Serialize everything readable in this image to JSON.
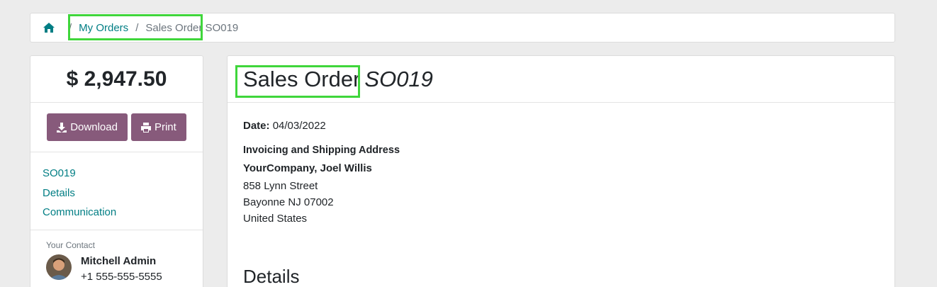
{
  "breadcrumb": {
    "home_icon": "home-icon",
    "separator": "/",
    "my_orders": "My Orders",
    "current": "Sales Order SO019"
  },
  "sidebar": {
    "amount": "$ 2,947.50",
    "download_label": "Download",
    "print_label": "Print",
    "links": [
      "SO019",
      "Details",
      "Communication"
    ],
    "contact_label": "Your Contact",
    "contact_name": "Mitchell Admin",
    "contact_phone": "+1 555-555-5555"
  },
  "main": {
    "title": "Sales Order",
    "reference": "SO019",
    "date_label": "Date:",
    "date_value": "04/03/2022",
    "address_title": "Invoicing and Shipping Address",
    "address_name": "YourCompany, Joel Willis",
    "address_lines": [
      "858 Lynn Street",
      "Bayonne NJ 07002",
      "United States"
    ],
    "details_title": "Details"
  },
  "colors": {
    "link": "#017e84",
    "button": "#875a7b",
    "highlight": "#3fd63b"
  }
}
